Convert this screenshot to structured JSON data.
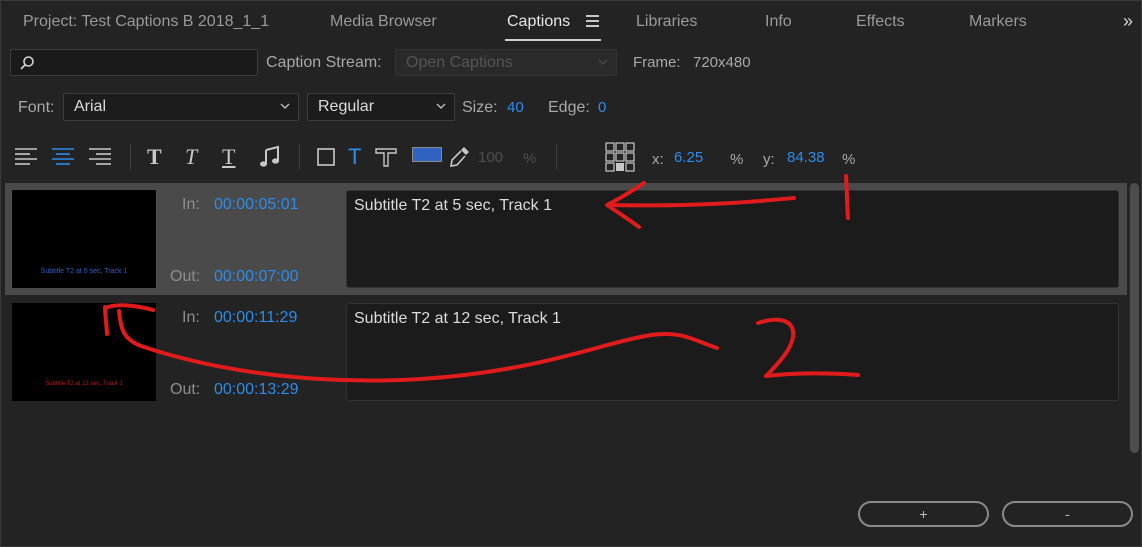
{
  "tabs": {
    "project": "Project: Test Captions B 2018_1_1",
    "media_browser": "Media Browser",
    "captions": "Captions",
    "libraries": "Libraries",
    "info": "Info",
    "effects": "Effects",
    "markers": "Markers",
    "overflow": "»"
  },
  "search": {
    "value": "",
    "placeholder": ""
  },
  "caption_stream": {
    "label": "Caption Stream:",
    "value": "Open Captions"
  },
  "frame": {
    "label": "Frame:",
    "value": "720x480"
  },
  "font": {
    "label": "Font:",
    "family": "Arial",
    "style": "Regular"
  },
  "size": {
    "label": "Size:",
    "value": "40"
  },
  "edge": {
    "label": "Edge:",
    "value": "0"
  },
  "toolbar": {
    "color": "#2f62c3",
    "opacity": "100",
    "opacity_unit": "%",
    "x_label": "x:",
    "x_value": "6.25",
    "x_unit": "%",
    "y_label": "y:",
    "y_value": "84.38",
    "y_unit": "%"
  },
  "captions": [
    {
      "in_label": "In:",
      "in": "00:00:05:01",
      "out_label": "Out:",
      "out": "00:00:07:00",
      "text": "Subtitle T2 at 5 sec, Track 1",
      "thumb_text": "Subtitle T2 at 5 sec, Track 1",
      "thumb_color": "#2f62c3",
      "selected": true
    },
    {
      "in_label": "In:",
      "in": "00:00:11:29",
      "out_label": "Out:",
      "out": "00:00:13:29",
      "text": "Subtitle T2 at 12 sec, Track 1",
      "thumb_text": "Subtitle T2 at 12 sec, Track 1",
      "thumb_color": "#c41a1a",
      "selected": false
    }
  ],
  "buttons": {
    "add": "+",
    "remove": "-"
  },
  "annotations": {
    "mark_1": "1",
    "mark_2": "2",
    "color": "#e01b1b"
  }
}
